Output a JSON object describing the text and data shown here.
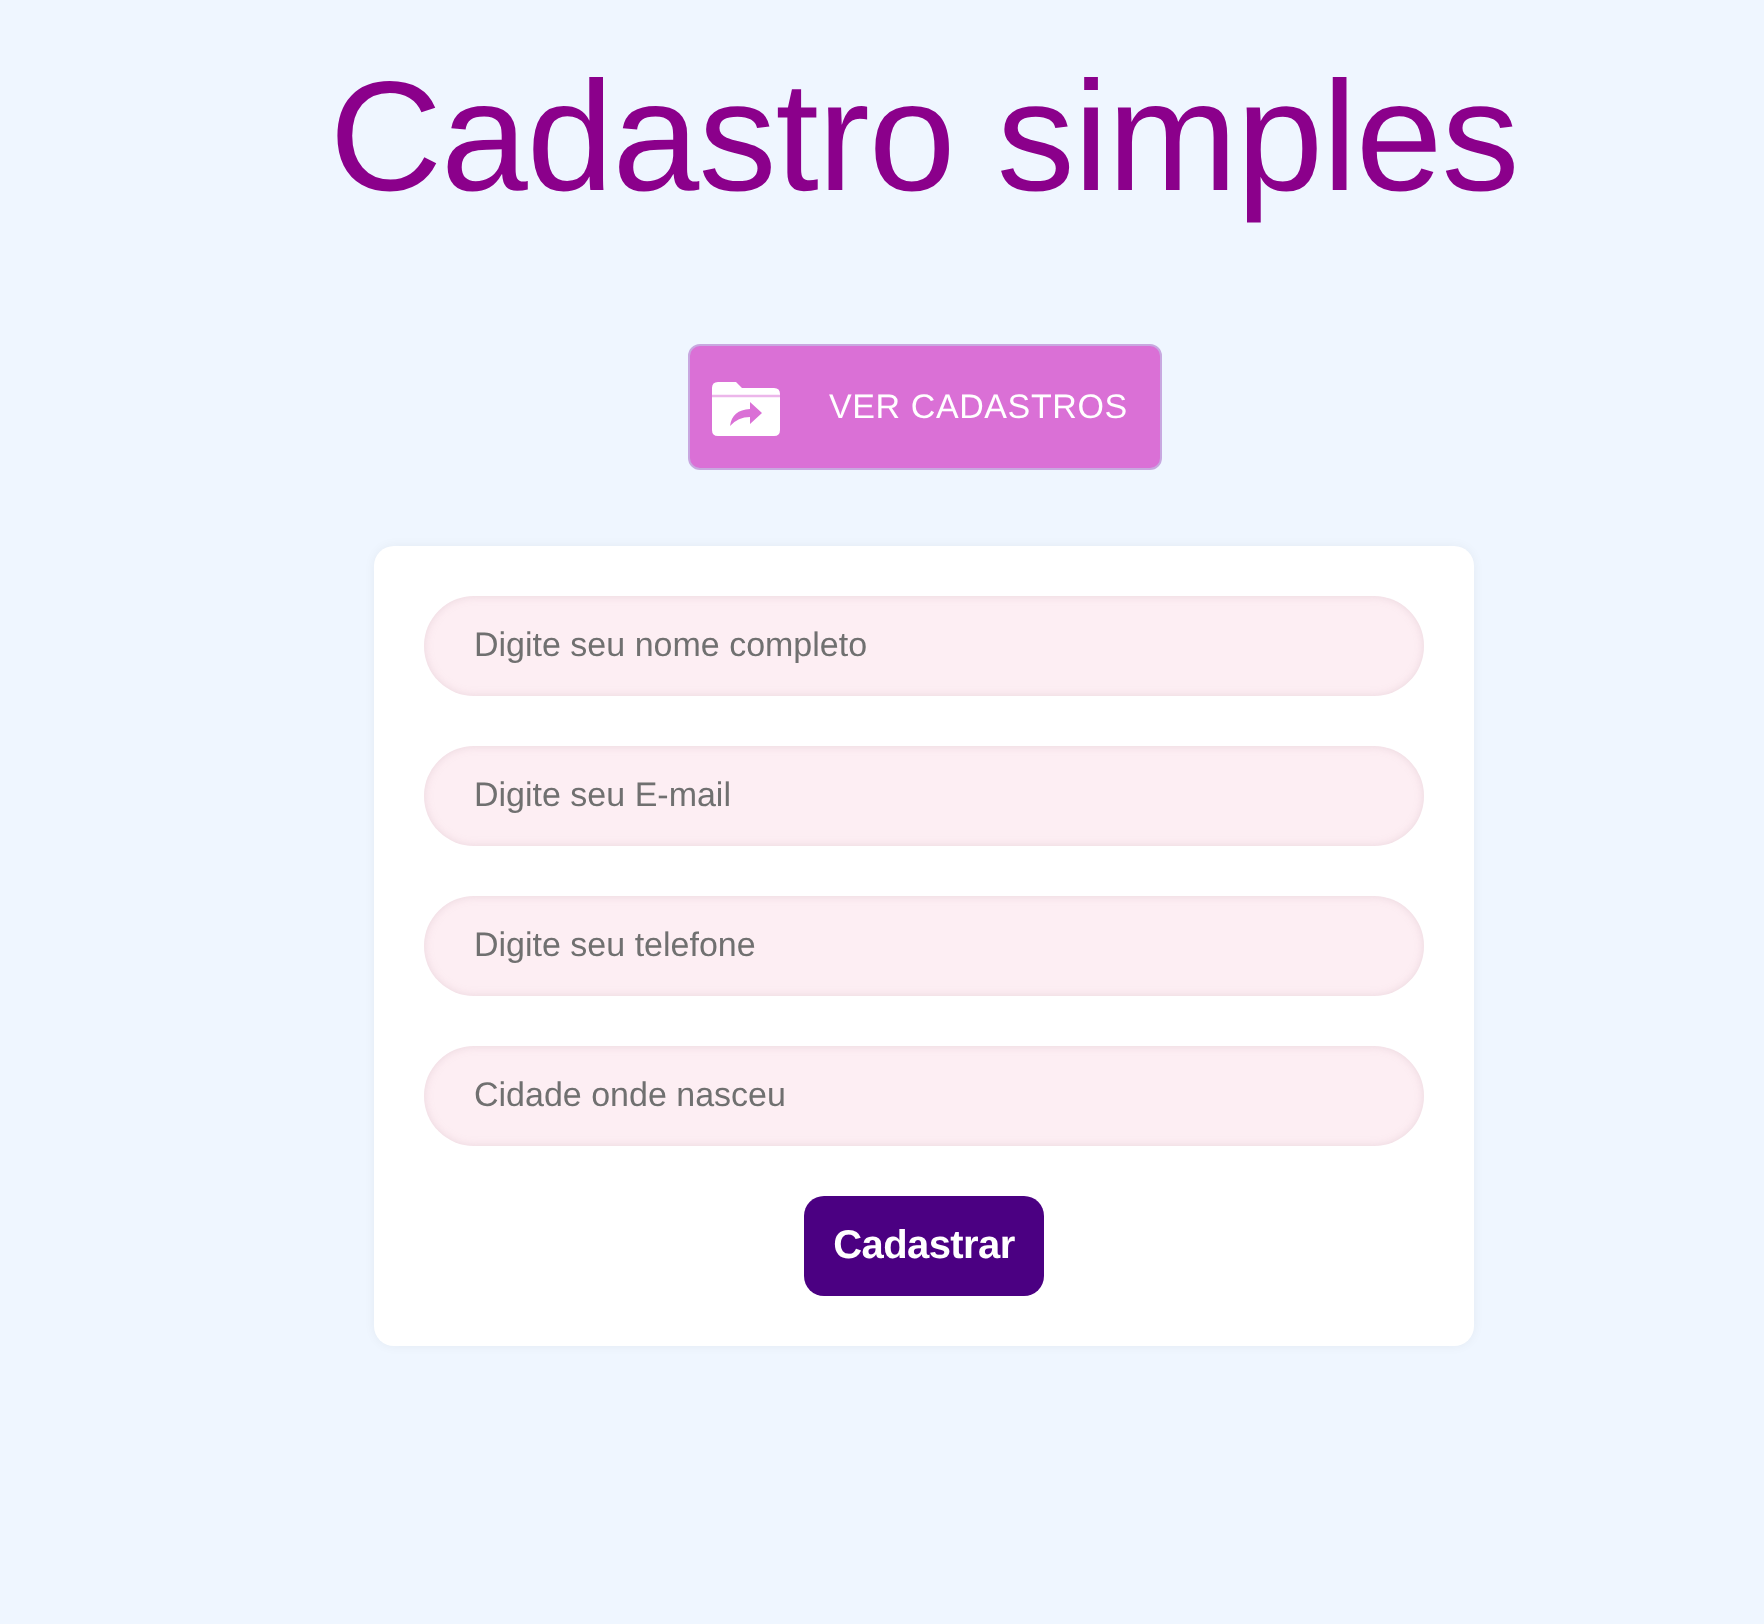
{
  "title": "Cadastro simples",
  "view_button": {
    "label": "VER CADASTROS"
  },
  "form": {
    "fields": [
      {
        "placeholder": "Digite seu nome completo"
      },
      {
        "placeholder": "Digite seu E-mail"
      },
      {
        "placeholder": "Digite seu telefone"
      },
      {
        "placeholder": "Cidade onde nasceu"
      }
    ],
    "submit": {
      "label": "Cadastrar"
    }
  }
}
